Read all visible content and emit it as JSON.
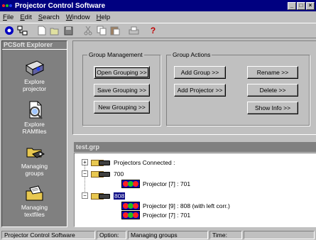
{
  "window": {
    "title": "Projector Control Software"
  },
  "menu": {
    "items": [
      {
        "label": "File",
        "key": "F",
        "rest": "ile"
      },
      {
        "label": "Edit",
        "key": "E",
        "rest": "dit"
      },
      {
        "label": "Search",
        "key": "S",
        "rest": "earch"
      },
      {
        "label": "Window",
        "key": "W",
        "rest": "indow"
      },
      {
        "label": "Help",
        "key": "H",
        "rest": "elp"
      }
    ]
  },
  "toolbar": {
    "icons": [
      "connect-icon",
      "network-icon",
      "new-icon",
      "open-icon",
      "save-icon",
      "cut-icon",
      "copy-icon",
      "paste-icon",
      "print-icon",
      "help-icon"
    ]
  },
  "sidebar": {
    "title": "PCSoft Explorer",
    "items": [
      {
        "label1": "Explore",
        "label2": "projector",
        "icon": "projector-icon"
      },
      {
        "label1": "Explore",
        "label2": "RAMfiles",
        "icon": "ramfiles-icon"
      },
      {
        "label1": "Managing",
        "label2": "groups",
        "icon": "groups-icon"
      },
      {
        "label1": "Managing",
        "label2": "textfiles",
        "icon": "textfiles-icon"
      }
    ]
  },
  "group_management": {
    "label": "Group Management",
    "buttons": [
      "Open Grouping >>",
      "Save Grouping >>",
      "New Grouping >>"
    ]
  },
  "group_actions": {
    "label": "Group Actions",
    "buttons": [
      "Add Group >>",
      "Add Projector >>",
      "Rename >>",
      "Delete >>",
      "Show Info >>"
    ]
  },
  "tree_pane": {
    "title": "test.grp",
    "rows": [
      {
        "text": "Projectors Connected :",
        "expander": "+"
      },
      {
        "text": "700",
        "expander": "−"
      },
      {
        "text": "Projector [7] : 701"
      },
      {
        "text": "808",
        "expander": "−"
      },
      {
        "text": "Projector [9] : 808 (with left corr.)"
      },
      {
        "text": "Projector [7] : 701"
      }
    ]
  },
  "status": {
    "app": "Projector Control Software",
    "option_label": "Option:",
    "option_value": "Managing groups",
    "time_label": "Time:"
  },
  "colors": {
    "titlebar": "#000080",
    "face": "#c0c0c0",
    "sidebar": "#808080"
  }
}
